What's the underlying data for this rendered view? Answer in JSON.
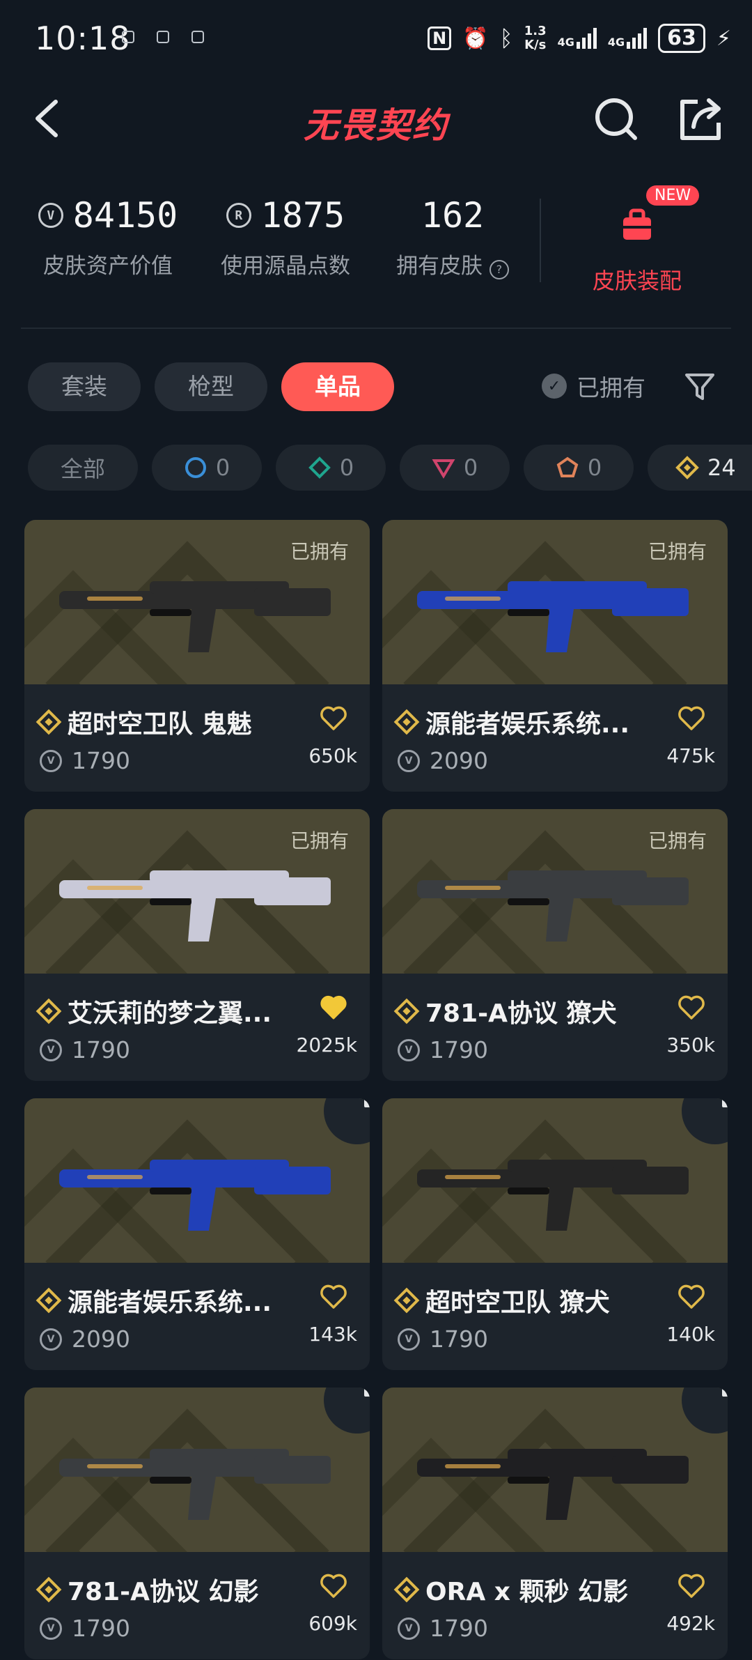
{
  "status_bar": {
    "time": "10:18",
    "speed_top": "1.3",
    "speed_bottom": "K/s",
    "net1": "4G",
    "net2": "4G",
    "battery": "63"
  },
  "header": {
    "title": "无畏契约"
  },
  "stats": {
    "asset_value": "84150",
    "asset_label": "皮肤资产价值",
    "radianite": "1875",
    "radianite_label": "使用源晶点数",
    "owned_count": "162",
    "owned_label": "拥有皮肤",
    "equip_badge": "NEW",
    "equip_label": "皮肤装配"
  },
  "tabs": [
    {
      "label": "套装"
    },
    {
      "label": "枪型"
    },
    {
      "label": "单品",
      "active": true
    }
  ],
  "owned_filter": {
    "label": "已拥有"
  },
  "tiers": [
    {
      "label": "全部"
    },
    {
      "count": "0",
      "color": "#3a8fd8",
      "icon": "select-tier-icon"
    },
    {
      "count": "0",
      "color": "#1fa58e",
      "icon": "deluxe-tier-icon"
    },
    {
      "count": "0",
      "color": "#d0446c",
      "icon": "premium-tier-icon"
    },
    {
      "count": "0",
      "color": "#e0835a",
      "icon": "ultra-tier-icon"
    },
    {
      "count": "24",
      "color": "#e0b94a",
      "icon": "exclusive-tier-icon"
    }
  ],
  "items": [
    {
      "name": "超时空卫队 鬼魅",
      "price": "1790",
      "likes": "650k",
      "owned_tag": "已拥有",
      "locked": false,
      "liked": false,
      "gun_color": "#2b2b2b"
    },
    {
      "name": "源能者娱乐系统...",
      "price": "2090",
      "likes": "475k",
      "owned_tag": "已拥有",
      "locked": false,
      "liked": false,
      "gun_color": "#2140b8"
    },
    {
      "name": "艾沃莉的梦之翼...",
      "price": "1790",
      "likes": "2025k",
      "owned_tag": "已拥有",
      "locked": false,
      "liked": true,
      "gun_color": "#c9c9d8"
    },
    {
      "name": "781-A协议 獠犬",
      "price": "1790",
      "likes": "350k",
      "owned_tag": "已拥有",
      "locked": false,
      "liked": false,
      "gun_color": "#3a3d40"
    },
    {
      "name": "源能者娱乐系统...",
      "price": "2090",
      "likes": "143k",
      "owned_tag": "",
      "locked": true,
      "liked": false,
      "gun_color": "#2140b8"
    },
    {
      "name": "超时空卫队 獠犬",
      "price": "1790",
      "likes": "140k",
      "owned_tag": "",
      "locked": true,
      "liked": false,
      "gun_color": "#252525"
    },
    {
      "name": "781-A协议 幻影",
      "price": "1790",
      "likes": "609k",
      "owned_tag": "",
      "locked": true,
      "liked": false,
      "gun_color": "#3a3d40"
    },
    {
      "name": "ORA x 颗秒 幻影",
      "price": "1790",
      "likes": "492k",
      "owned_tag": "",
      "locked": true,
      "liked": false,
      "gun_color": "#1f1f22"
    }
  ],
  "colors": {
    "accent": "#ff4552",
    "gold": "#e0b94a",
    "background": "#111821",
    "card": "#1d242c"
  }
}
